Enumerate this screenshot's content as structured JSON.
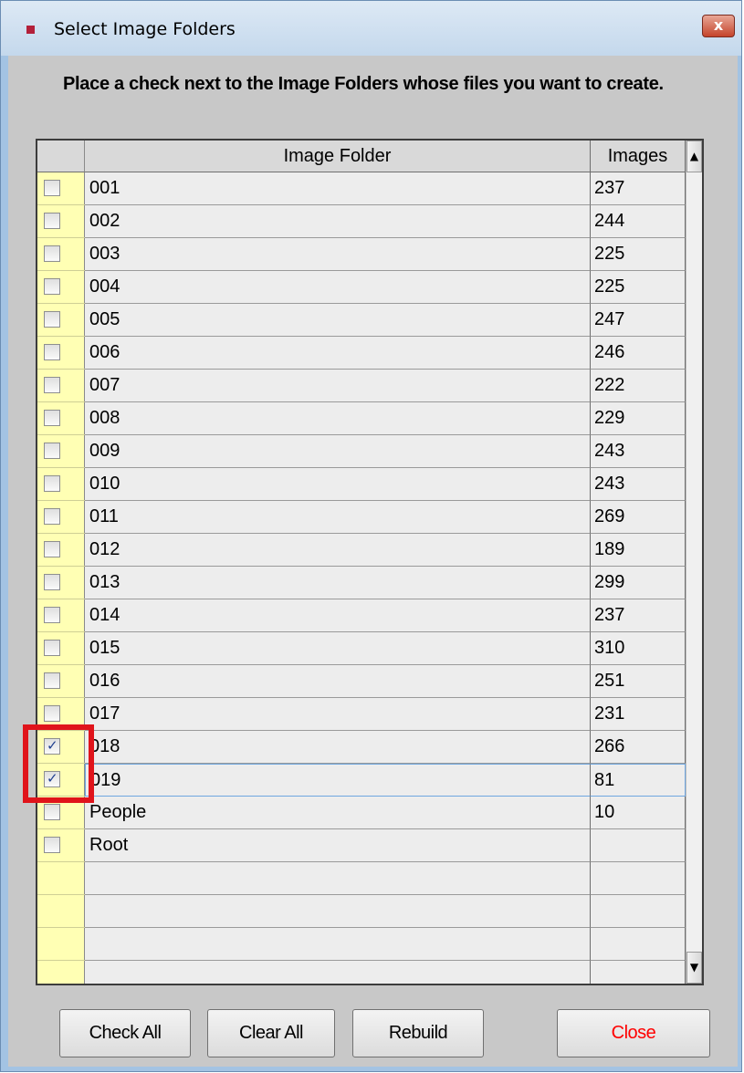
{
  "window": {
    "title": "Select Image Folders",
    "close_glyph": "x"
  },
  "instructions": "Place a check next to the Image Folders whose files you want to create.",
  "grid": {
    "columns": [
      "Image Folder",
      "Images"
    ],
    "rows": [
      {
        "folder": "001",
        "images": "237",
        "checked": false
      },
      {
        "folder": "002",
        "images": "244",
        "checked": false
      },
      {
        "folder": "003",
        "images": "225",
        "checked": false
      },
      {
        "folder": "004",
        "images": "225",
        "checked": false
      },
      {
        "folder": "005",
        "images": "247",
        "checked": false
      },
      {
        "folder": "006",
        "images": "246",
        "checked": false
      },
      {
        "folder": "007",
        "images": "222",
        "checked": false
      },
      {
        "folder": "008",
        "images": "229",
        "checked": false
      },
      {
        "folder": "009",
        "images": "243",
        "checked": false
      },
      {
        "folder": "010",
        "images": "243",
        "checked": false
      },
      {
        "folder": "011",
        "images": "269",
        "checked": false
      },
      {
        "folder": "012",
        "images": "189",
        "checked": false
      },
      {
        "folder": "013",
        "images": "299",
        "checked": false
      },
      {
        "folder": "014",
        "images": "237",
        "checked": false
      },
      {
        "folder": "015",
        "images": "310",
        "checked": false
      },
      {
        "folder": "016",
        "images": "251",
        "checked": false
      },
      {
        "folder": "017",
        "images": "231",
        "checked": false
      },
      {
        "folder": "018",
        "images": "266",
        "checked": true
      },
      {
        "folder": "019",
        "images": "81",
        "checked": true,
        "selected": true
      },
      {
        "folder": "People",
        "images": "10",
        "checked": false
      },
      {
        "folder": "Root",
        "images": "",
        "checked": false
      }
    ],
    "empty_rows": 4
  },
  "buttons": {
    "check_all": "Check All",
    "clear_all": "Clear All",
    "rebuild": "Rebuild",
    "close": "Close"
  },
  "colors": {
    "checkbox_column": "#ffffb4",
    "highlight": "#e0141b",
    "close_text": "#ff0000",
    "selected_row_border": "#6fa7e0"
  }
}
